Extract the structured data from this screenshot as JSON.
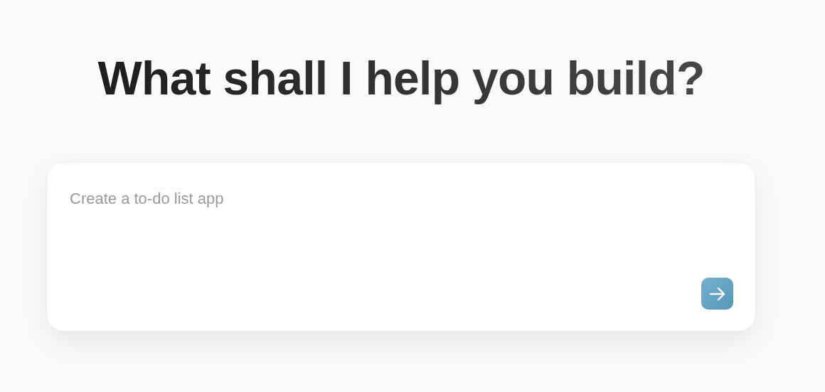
{
  "heading": "What shall I help you build?",
  "prompt": {
    "placeholder": "Create a to-do list app"
  },
  "submit_button": {
    "disabled": false
  }
}
